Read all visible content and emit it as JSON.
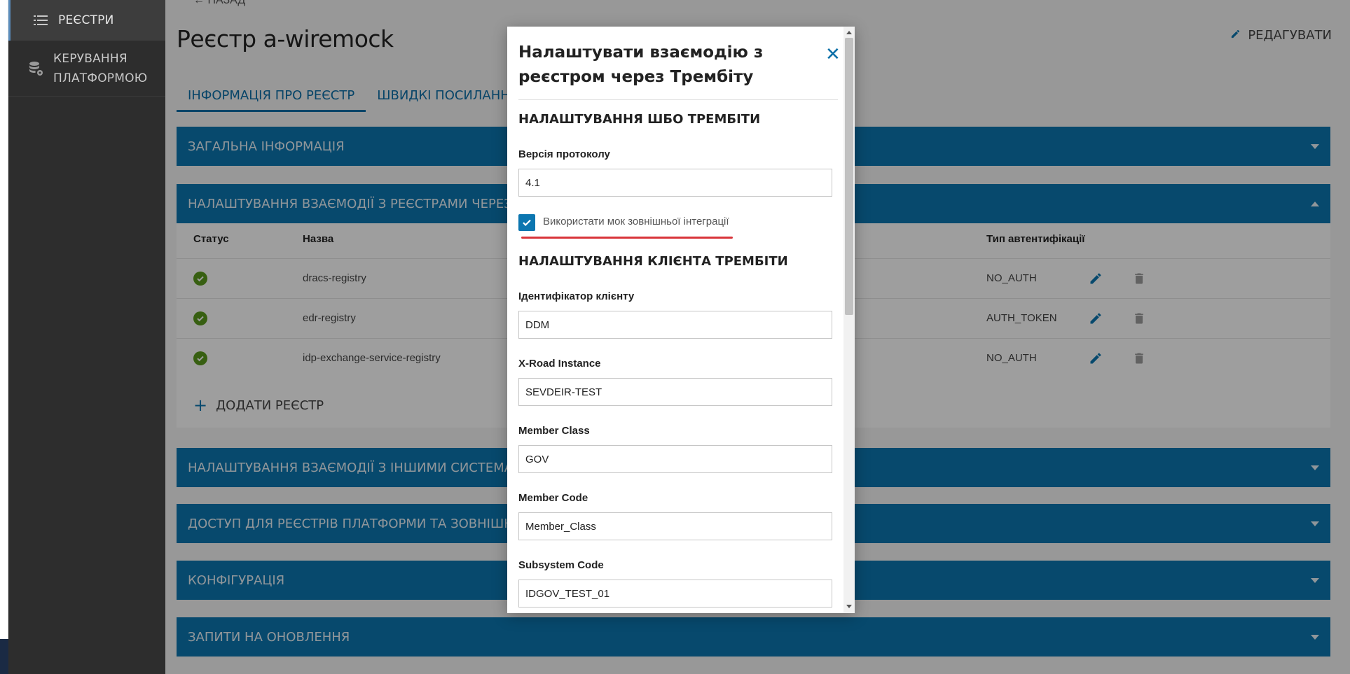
{
  "sidebar": {
    "items": [
      {
        "label": "РЕЄСТРИ",
        "icon": "list-icon"
      },
      {
        "label_line1": "КЕРУВАННЯ",
        "label_line2": "ПЛАТФОРМОЮ",
        "icon": "database-settings-icon"
      }
    ]
  },
  "page": {
    "back_label": "НАЗАД",
    "title": "Реєстр a-wiremock",
    "edit_label": "РЕДАГУВАТИ",
    "tabs": [
      {
        "label": "ІНФОРМАЦІЯ ПРО РЕЄСТР"
      },
      {
        "label": "ШВИДКІ ПОСИЛАННЯ"
      }
    ],
    "sections": [
      {
        "title": "ЗАГАЛЬНА ІНФОРМАЦІЯ"
      },
      {
        "title": "НАЛАШТУВАННЯ ВЗАЄМОДІЇ З РЕЄСТРАМИ ЧЕРЕЗ ТРЕМБІТУ"
      },
      {
        "title": "НАЛАШТУВАННЯ ВЗАЄМОДІЇ З ІНШИМИ СИСТЕМАМИ"
      },
      {
        "title": "ДОСТУП ДЛЯ РЕЄСТРІВ ПЛАТФОРМИ ТА ЗОВНІШНІХ СИСТЕМ"
      },
      {
        "title": "КОНФІГУРАЦІЯ"
      },
      {
        "title": "ЗАПИТИ НА ОНОВЛЕННЯ"
      }
    ],
    "table": {
      "headers": [
        "Статус",
        "Назва",
        "Тип автентифікації"
      ],
      "rows": [
        {
          "name": "dracs-registry",
          "auth": "NO_AUTH"
        },
        {
          "name": "edr-registry",
          "auth": "AUTH_TOKEN"
        },
        {
          "name": "idp-exchange-service-registry",
          "auth": "NO_AUTH"
        }
      ],
      "add_label": "ДОДАТИ РЕЄСТР"
    }
  },
  "modal": {
    "title": "Налаштувати взаємодію з реєстром через Трембіту",
    "section1": "НАЛАШТУВАННЯ ШБО ТРЕМБІТИ",
    "protocol_label": "Версія протоколу",
    "protocol_value": "4.1",
    "mock_label": "Використати мок зовнішньої інтеграції",
    "section2": "НАЛАШТУВАННЯ КЛІЄНТА ТРЕМБІТИ",
    "fields": [
      {
        "label": "Ідентифікатор клієнту",
        "value": "DDM"
      },
      {
        "label": "X-Road Instance",
        "value": "SEVDEIR-TEST"
      },
      {
        "label": "Member Class",
        "value": "GOV"
      },
      {
        "label": "Member Code",
        "value": "Member_Class"
      },
      {
        "label": "Subsystem Code",
        "value": "IDGOV_TEST_01"
      }
    ]
  },
  "colors": {
    "accent": "#0c76b0",
    "sidebar": "#2d2d2d",
    "success": "#5a9a1c",
    "annotation": "#d8343a"
  }
}
